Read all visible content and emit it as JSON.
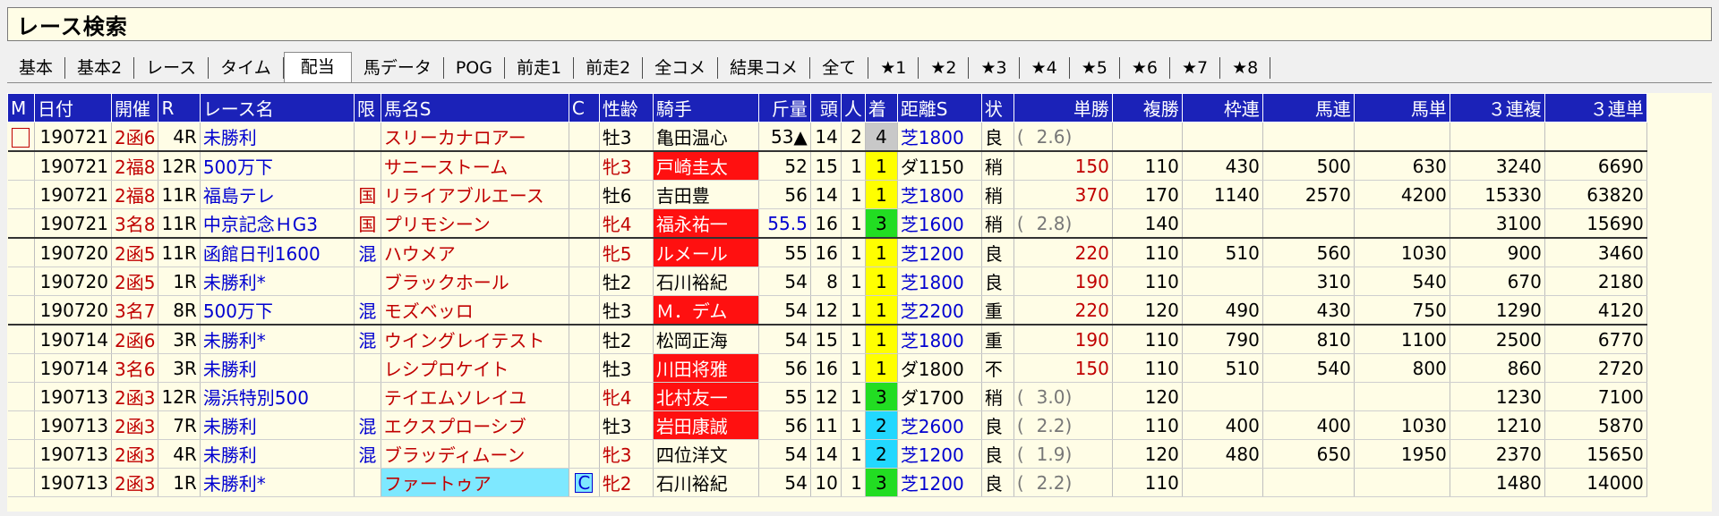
{
  "title": "レース検索",
  "tabs": [
    "基本",
    "基本2",
    "レース",
    "タイム",
    "配当",
    "馬データ",
    "POG",
    "前走1",
    "前走2",
    "全コメ",
    "結果コメ",
    "全て",
    "★1",
    "★2",
    "★3",
    "★4",
    "★5",
    "★6",
    "★7",
    "★8"
  ],
  "active_tab": "配当",
  "columns": [
    "M",
    "日付",
    "開催",
    "R",
    "レース名",
    "限",
    "馬名S",
    "C",
    "性齢",
    "騎手",
    "斤量",
    "頭",
    "人",
    "着",
    "距離S",
    "状",
    "単勝",
    "複勝",
    "枠連",
    "馬連",
    "馬単",
    "３連複",
    "３連単"
  ],
  "rows": [
    {
      "m": "",
      "date": "190721",
      "venue": "2函6",
      "r": "4R",
      "race": "未勝利",
      "gen": "",
      "horse": "スリーカナロアー",
      "c": "",
      "sex": "牡3",
      "jockey": "亀田温心",
      "kin": "53▲",
      "to": "14",
      "nin": "2",
      "chaku": "4",
      "dist": "芝1800",
      "jo": "良",
      "tan": "2.6",
      "fuku": "",
      "waku": "",
      "umaren": "",
      "umatan": "",
      "sanfuku": "",
      "santan": ""
    },
    {
      "m": "",
      "date": "190721",
      "venue": "2福8",
      "r": "12R",
      "race": "500万下",
      "gen": "",
      "horse": "サニーストーム",
      "c": "",
      "sex": "牝3",
      "jockey": "戸崎圭太",
      "kin": "52",
      "to": "15",
      "nin": "1",
      "chaku": "1",
      "dist": "ダ1150",
      "jo": "稍",
      "tan": "150",
      "fuku": "110",
      "waku": "430",
      "umaren": "500",
      "umatan": "630",
      "sanfuku": "3240",
      "santan": "6690"
    },
    {
      "m": "",
      "date": "190721",
      "venue": "2福8",
      "r": "11R",
      "race": "福島テレ",
      "gen": "国",
      "horse": "リライアブルエース",
      "c": "",
      "sex": "牡6",
      "jockey": "吉田豊",
      "kin": "56",
      "to": "14",
      "nin": "1",
      "chaku": "1",
      "dist": "芝1800",
      "jo": "稍",
      "tan": "370",
      "fuku": "170",
      "waku": "1140",
      "umaren": "2570",
      "umatan": "4200",
      "sanfuku": "15330",
      "santan": "63820"
    },
    {
      "m": "",
      "date": "190721",
      "venue": "3名8",
      "r": "11R",
      "race": "中京記念ＨG3",
      "gen": "国",
      "horse": "プリモシーン",
      "c": "",
      "sex": "牝4",
      "jockey": "福永祐一",
      "kin": "55.5",
      "to": "16",
      "nin": "1",
      "chaku": "3",
      "dist": "芝1600",
      "jo": "稍",
      "tan": "2.8",
      "fuku": "140",
      "waku": "",
      "umaren": "",
      "umatan": "",
      "sanfuku": "3100",
      "santan": "15690"
    },
    {
      "m": "",
      "date": "190720",
      "venue": "2函5",
      "r": "11R",
      "race": "函館日刊1600",
      "gen": "混",
      "horse": "ハウメア",
      "c": "",
      "sex": "牝5",
      "jockey": "ルメール",
      "kin": "55",
      "to": "16",
      "nin": "1",
      "chaku": "1",
      "dist": "芝1200",
      "jo": "良",
      "tan": "220",
      "fuku": "110",
      "waku": "510",
      "umaren": "560",
      "umatan": "1030",
      "sanfuku": "900",
      "santan": "3460"
    },
    {
      "m": "",
      "date": "190720",
      "venue": "2函5",
      "r": "1R",
      "race": "未勝利*",
      "gen": "",
      "horse": "ブラックホール",
      "c": "",
      "sex": "牡2",
      "jockey": "石川裕紀",
      "kin": "54",
      "to": "8",
      "nin": "1",
      "chaku": "1",
      "dist": "芝1800",
      "jo": "良",
      "tan": "190",
      "fuku": "110",
      "waku": "",
      "umaren": "310",
      "umatan": "540",
      "sanfuku": "670",
      "santan": "2180"
    },
    {
      "m": "",
      "date": "190720",
      "venue": "3名7",
      "r": "8R",
      "race": "500万下",
      "gen": "混",
      "horse": "モズベッロ",
      "c": "",
      "sex": "牡3",
      "jockey": "Ｍ．デム",
      "kin": "54",
      "to": "12",
      "nin": "1",
      "chaku": "1",
      "dist": "芝2200",
      "jo": "重",
      "tan": "220",
      "fuku": "120",
      "waku": "490",
      "umaren": "430",
      "umatan": "750",
      "sanfuku": "1290",
      "santan": "4120"
    },
    {
      "m": "",
      "date": "190714",
      "venue": "2函6",
      "r": "3R",
      "race": "未勝利*",
      "gen": "混",
      "horse": "ウイングレイテスト",
      "c": "",
      "sex": "牡2",
      "jockey": "松岡正海",
      "kin": "54",
      "to": "15",
      "nin": "1",
      "chaku": "1",
      "dist": "芝1800",
      "jo": "重",
      "tan": "190",
      "fuku": "110",
      "waku": "790",
      "umaren": "810",
      "umatan": "1100",
      "sanfuku": "2500",
      "santan": "6770"
    },
    {
      "m": "",
      "date": "190714",
      "venue": "3名6",
      "r": "3R",
      "race": "未勝利",
      "gen": "",
      "horse": "レシプロケイト",
      "c": "",
      "sex": "牡3",
      "jockey": "川田将雅",
      "kin": "56",
      "to": "16",
      "nin": "1",
      "chaku": "1",
      "dist": "ダ1800",
      "jo": "不",
      "tan": "150",
      "fuku": "110",
      "waku": "510",
      "umaren": "540",
      "umatan": "800",
      "sanfuku": "860",
      "santan": "2720"
    },
    {
      "m": "",
      "date": "190713",
      "venue": "2函3",
      "r": "12R",
      "race": "湯浜特別500",
      "gen": "",
      "horse": "テイエムソレイユ",
      "c": "",
      "sex": "牝4",
      "jockey": "北村友一",
      "kin": "55",
      "to": "12",
      "nin": "1",
      "chaku": "3",
      "dist": "ダ1700",
      "jo": "稍",
      "tan": "3.0",
      "fuku": "120",
      "waku": "",
      "umaren": "",
      "umatan": "",
      "sanfuku": "1230",
      "santan": "7100"
    },
    {
      "m": "",
      "date": "190713",
      "venue": "2函3",
      "r": "7R",
      "race": "未勝利",
      "gen": "混",
      "horse": "エクスプローシブ",
      "c": "",
      "sex": "牡3",
      "jockey": "岩田康誠",
      "kin": "56",
      "to": "11",
      "nin": "1",
      "chaku": "2",
      "dist": "芝2600",
      "jo": "良",
      "tan": "2.2",
      "fuku": "110",
      "waku": "400",
      "umaren": "400",
      "umatan": "1030",
      "sanfuku": "1210",
      "santan": "5870"
    },
    {
      "m": "",
      "date": "190713",
      "venue": "2函3",
      "r": "4R",
      "race": "未勝利",
      "gen": "混",
      "horse": "ブラッディムーン",
      "c": "",
      "sex": "牝3",
      "jockey": "四位洋文",
      "kin": "54",
      "to": "14",
      "nin": "1",
      "chaku": "2",
      "dist": "芝1200",
      "jo": "良",
      "tan": "1.9",
      "fuku": "120",
      "waku": "480",
      "umaren": "650",
      "umatan": "1950",
      "sanfuku": "2370",
      "santan": "15650"
    },
    {
      "m": "",
      "date": "190713",
      "venue": "2函3",
      "r": "1R",
      "race": "未勝利*",
      "gen": "",
      "horse": "ファートゥア",
      "c": "C",
      "sex": "牝2",
      "jockey": "石川裕紀",
      "kin": "54",
      "to": "10",
      "nin": "1",
      "chaku": "3",
      "dist": "芝1200",
      "jo": "良",
      "tan": "2.2",
      "fuku": "110",
      "waku": "",
      "umaren": "",
      "umatan": "",
      "sanfuku": "1480",
      "santan": "14000"
    }
  ]
}
